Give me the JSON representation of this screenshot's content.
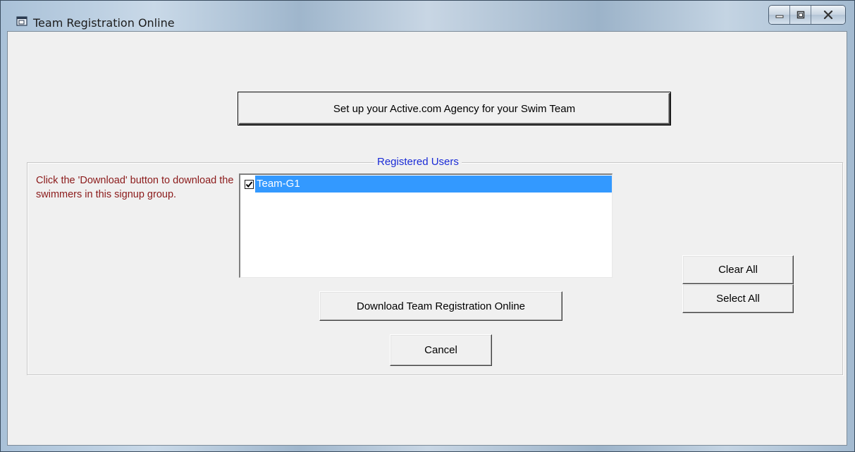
{
  "window": {
    "title": "Team Registration Online"
  },
  "caption_buttons": {
    "minimize_icon": "minimize-icon",
    "maximize_icon": "maximize-icon",
    "close_icon": "close-icon"
  },
  "setup_button": {
    "label": "Set up your Active.com Agency for your Swim Team"
  },
  "registered_users": {
    "legend": "Registered Users",
    "help_text": "Click the 'Download' button to download the swimmers in this signup group.",
    "items": [
      {
        "label": "Team-G1",
        "checked": true,
        "selected": true
      }
    ]
  },
  "buttons": {
    "download": "Download Team Registration Online",
    "cancel": "Cancel",
    "clear_all": "Clear All",
    "select_all": "Select All"
  },
  "colors": {
    "legend": "#1a2bd6",
    "help_text": "#8b1a1a",
    "selection": "#3399ff",
    "dialog_bg": "#f0f0f0"
  }
}
